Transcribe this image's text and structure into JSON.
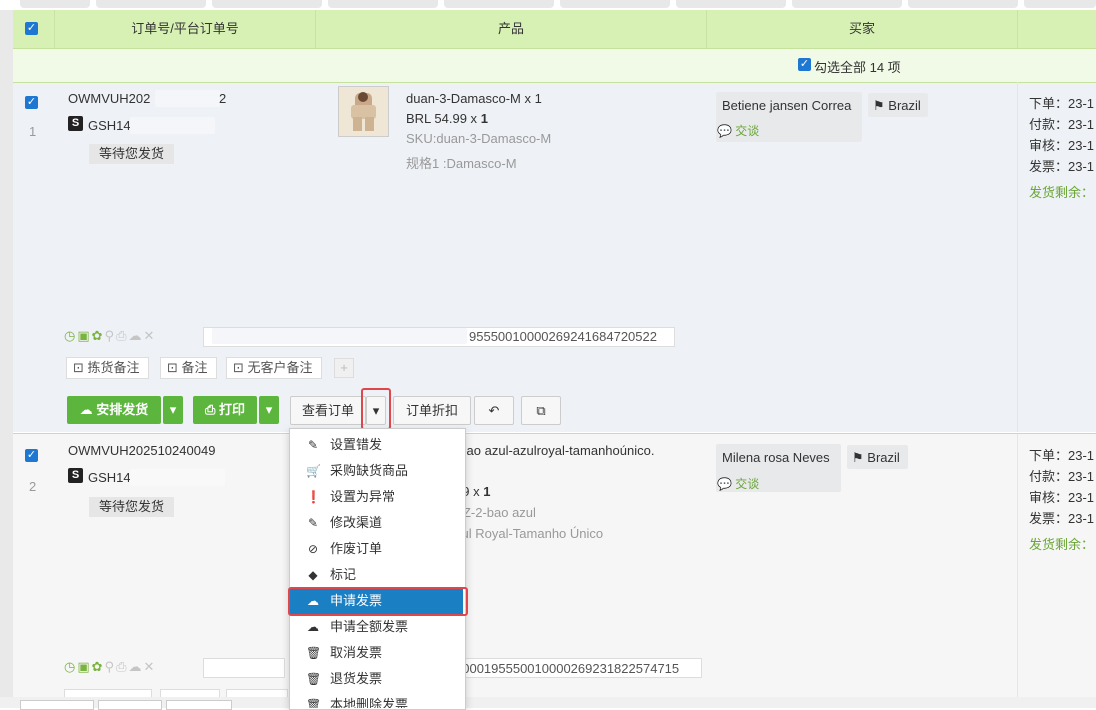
{
  "colors": {
    "accent_green": "#5cb53d",
    "header_bg": "#d7f0b4",
    "highlight_blue": "#1b7fc4",
    "annotation_red": "#e0474c"
  },
  "table": {
    "headers": {
      "order": "订单号/平台订单号",
      "product": "产品",
      "buyer": "买家"
    },
    "select_all_label": "勾选全部 14 项"
  },
  "orders": [
    {
      "index": "1",
      "order_no": "OWMVUH202",
      "order_no_tail": "2",
      "platform_no": "GSH14",
      "status": "等待您发货",
      "product_title": "duan-3-Damasco-M x 1",
      "price": "BRL 54.99 x ",
      "qty": "1",
      "sku": "SKU:duan-3-Damasco-M",
      "spec": "规格1 :Damasco-M",
      "buyer_name": "Betiene jansen Correa",
      "country": "Brazil",
      "chat": "交谈",
      "date_labels": [
        "下单：",
        "付款：",
        "审核：",
        "发票："
      ],
      "date_values": [
        "23-1",
        "23-1",
        "23-1",
        "23-1"
      ],
      "ship_remaining": "发货剩余：",
      "tracking": "9555001000026924168472052‌2"
    },
    {
      "index": "2",
      "order_no": "OWMVUH202510240049",
      "platform_no": "GSH14",
      "status": "等待您发货",
      "product_title": "-bao azul-azulroyal-tamanhoúnico.",
      "price": "99 x ",
      "qty": "1",
      "sku": "TZ-2-bao azul",
      "spec": "zul Royal-Tamanho Único",
      "buyer_name": "Milena rosa Neves",
      "country": "Brazil",
      "chat": "交谈",
      "date_labels": [
        "下单：",
        "付款：",
        "审核：",
        "发票："
      ],
      "date_values": [
        "23-1",
        "23-1",
        "23-1",
        "23-1"
      ],
      "ship_remaining": "发货剩余：",
      "tracking": "100019555001000026923182257471‌5"
    }
  ],
  "notes": {
    "pick": "拣货备注",
    "note": "备注",
    "no_customer": "无客户备注"
  },
  "actions": {
    "arrange": "安排发货",
    "print": "打印",
    "view_order": "查看订单",
    "discount": "订单折扣"
  },
  "dropdown_menu": [
    {
      "icon": "edit-icon",
      "label": "设置错发"
    },
    {
      "icon": "cart-icon",
      "label": "采购缺货商品"
    },
    {
      "icon": "exclamation-icon",
      "label": "设置为异常"
    },
    {
      "icon": "edit-icon",
      "label": "修改渠道"
    },
    {
      "icon": "ban-icon",
      "label": "作废订单"
    },
    {
      "icon": "tag-icon",
      "label": "标记"
    },
    {
      "icon": "cloud-upload-icon",
      "label": "申请发票",
      "highlighted": true
    },
    {
      "icon": "cloud-upload-icon",
      "label": "申请全额发票"
    },
    {
      "icon": "trash-icon",
      "label": "取消发票"
    },
    {
      "icon": "trash-icon",
      "label": "退货发票"
    },
    {
      "icon": "trash-icon",
      "label": "本地删除发票"
    }
  ]
}
